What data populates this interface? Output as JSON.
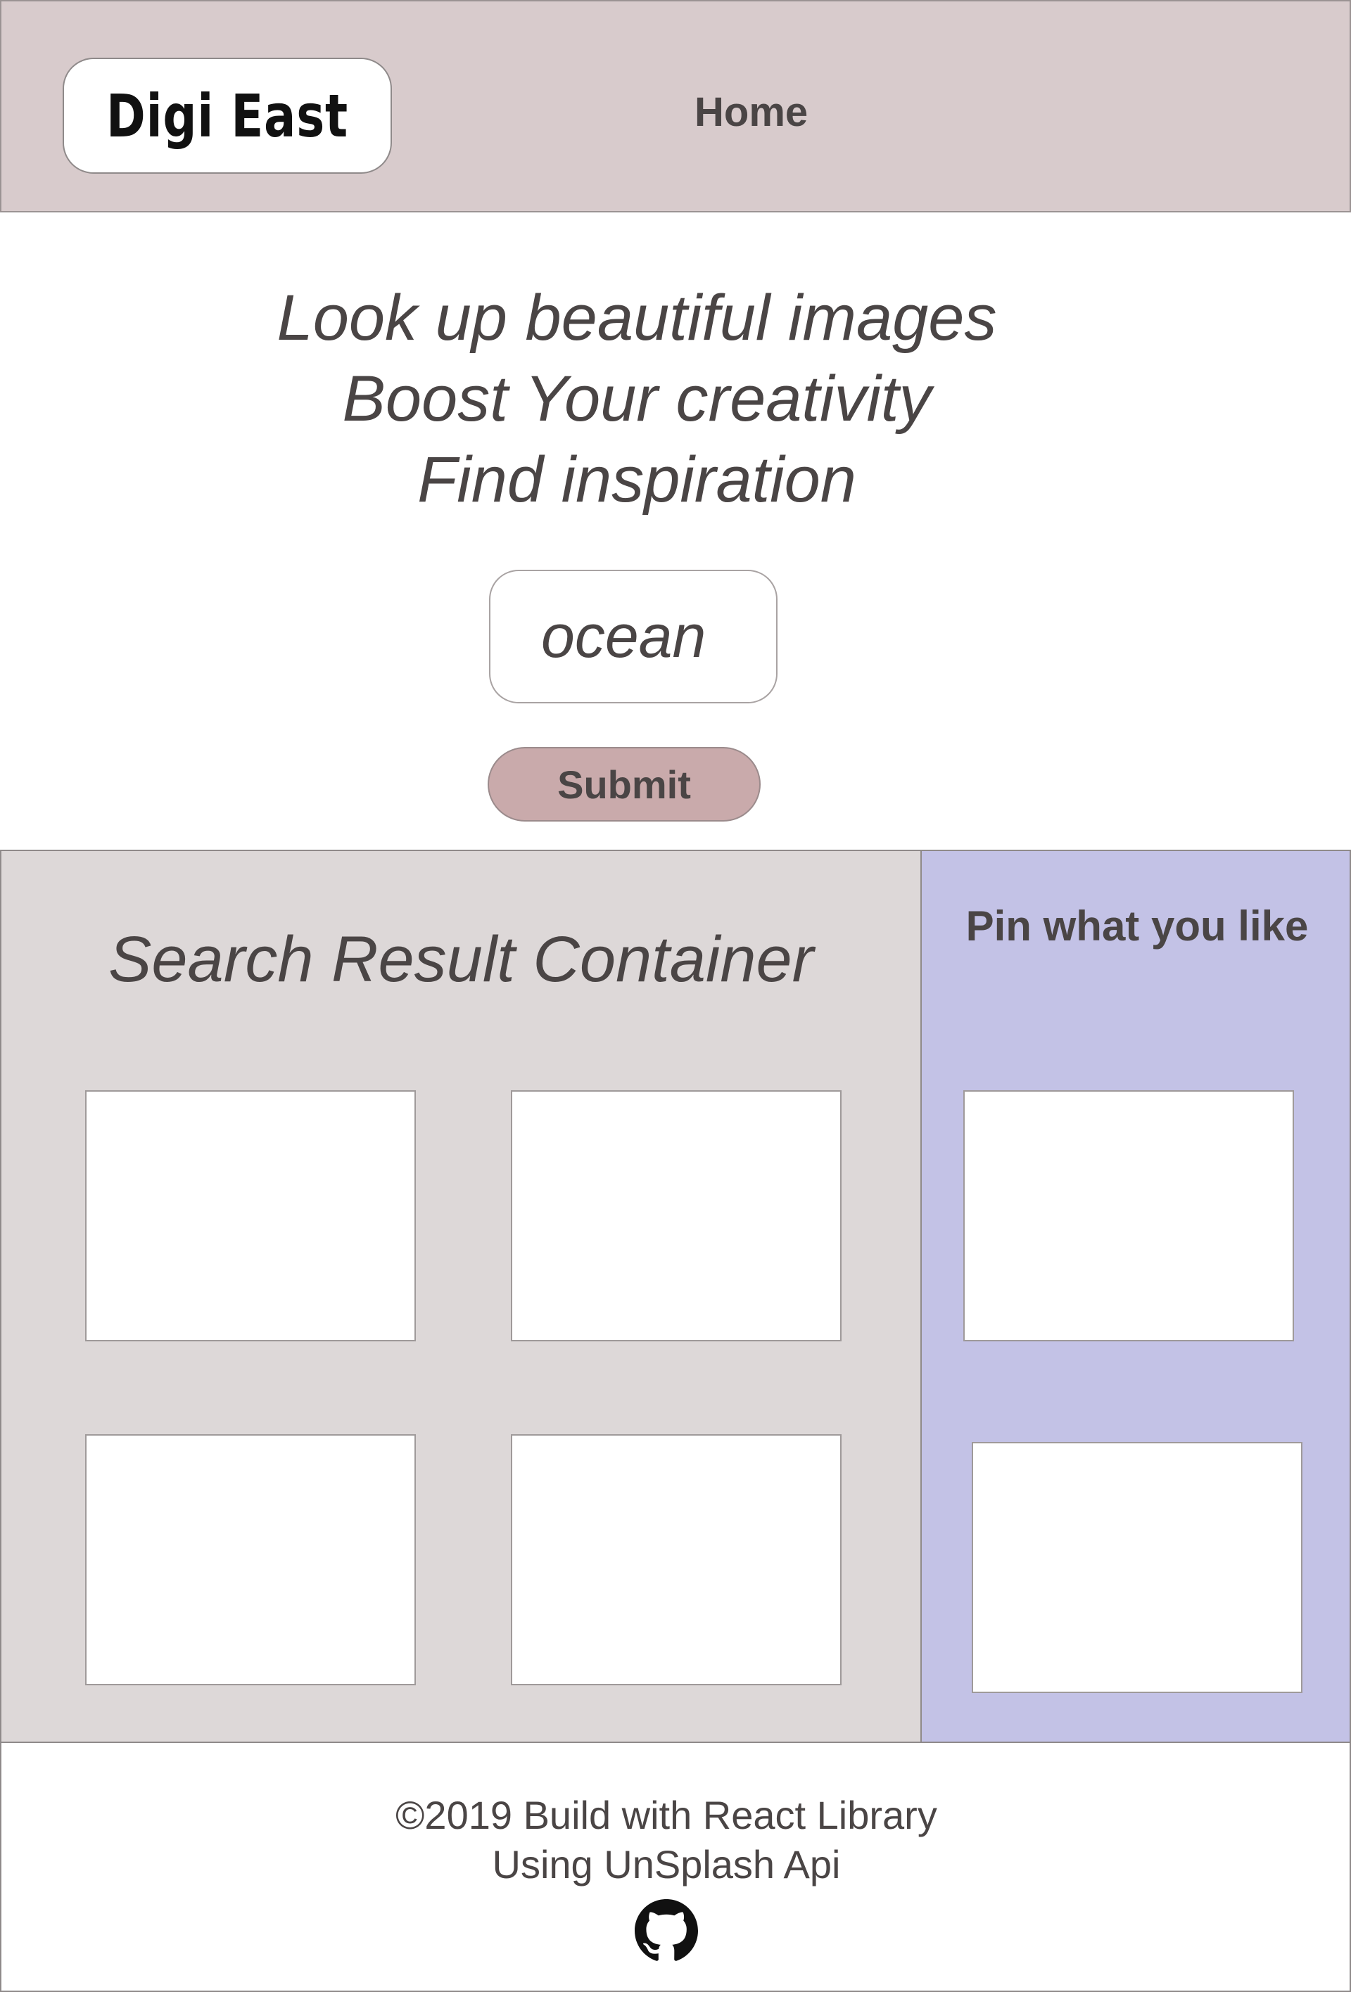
{
  "header": {
    "logo_text": "Digi East",
    "nav": {
      "home_label": "Home"
    }
  },
  "hero": {
    "lines": [
      "Look up beautiful images",
      "Boost Your creativity",
      "Find inspiration"
    ]
  },
  "search": {
    "placeholder": "ocean",
    "value": ""
  },
  "submit": {
    "label": "Submit"
  },
  "results": {
    "title": "Search Result Container"
  },
  "pins": {
    "title": "Pin what you like"
  },
  "footer": {
    "line1": "©2019 Build with React Library",
    "line2": "Using UnSplash Api",
    "icon": "github-icon"
  },
  "colors": {
    "header_bg": "#d8cbcc",
    "results_bg": "#ddd8d8",
    "pins_bg": "#c3c2e6",
    "submit_bg": "#c9aaab",
    "text": "#4a4545"
  }
}
